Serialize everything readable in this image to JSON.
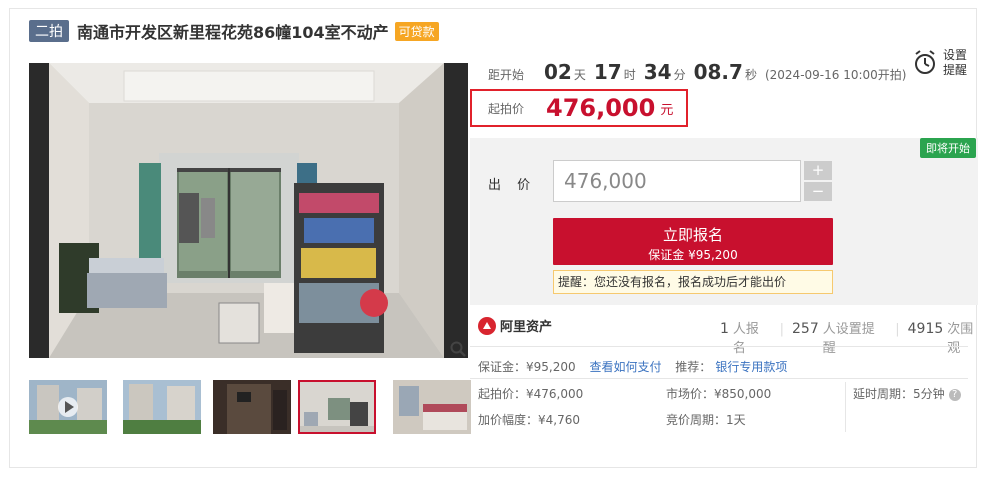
{
  "header": {
    "round_tag": "二拍",
    "title": "南通市开发区新里程花苑86幢104室不动产",
    "loan_tag": "可贷款"
  },
  "countdown": {
    "label": "距开始",
    "days": "02",
    "days_unit": "天",
    "hours": "17",
    "hours_unit": "时",
    "minutes": "34",
    "minutes_unit": "分",
    "seconds": "08.7",
    "seconds_unit": "秒",
    "start_time": "(2024-09-16 10:00开拍)"
  },
  "remind": {
    "label": "设置提醒",
    "icon": "alarm-clock-icon"
  },
  "start_price": {
    "label": "起拍价",
    "value": "476,000",
    "unit": "元"
  },
  "status_badge": "即将开始",
  "bid": {
    "label": "出 价",
    "value": "476,000",
    "plus": "+",
    "minus": "−"
  },
  "signup": {
    "label": "立即报名",
    "deposit": "保证金 ¥95,200"
  },
  "tip": "提醒：您还没有报名，报名成功后才能出价",
  "platform": {
    "name": "阿里资产",
    "icon": "ali-assets-logo-icon"
  },
  "stats": {
    "signups": "1",
    "signups_label": "人报名",
    "reminders": "257",
    "reminders_label": "人设置提醒",
    "views": "4915",
    "views_label": "次围观"
  },
  "details": {
    "deposit_label": "保证金：¥95,200",
    "deposit_link": "查看如何支付",
    "recommend_label": "推荐：",
    "recommend_link": "银行专用款项",
    "start_price": "起拍价：¥476,000",
    "market_price": "市场价：¥850,000",
    "delay_period": "延时周期：5分钟",
    "increment": "加价幅度：¥4,760",
    "bid_period": "竞价周期：1天"
  },
  "colors": {
    "accent": "#c8102e",
    "link": "#3b73c0",
    "badge_green": "#2ba44f",
    "loan_orange": "#f6a623"
  }
}
